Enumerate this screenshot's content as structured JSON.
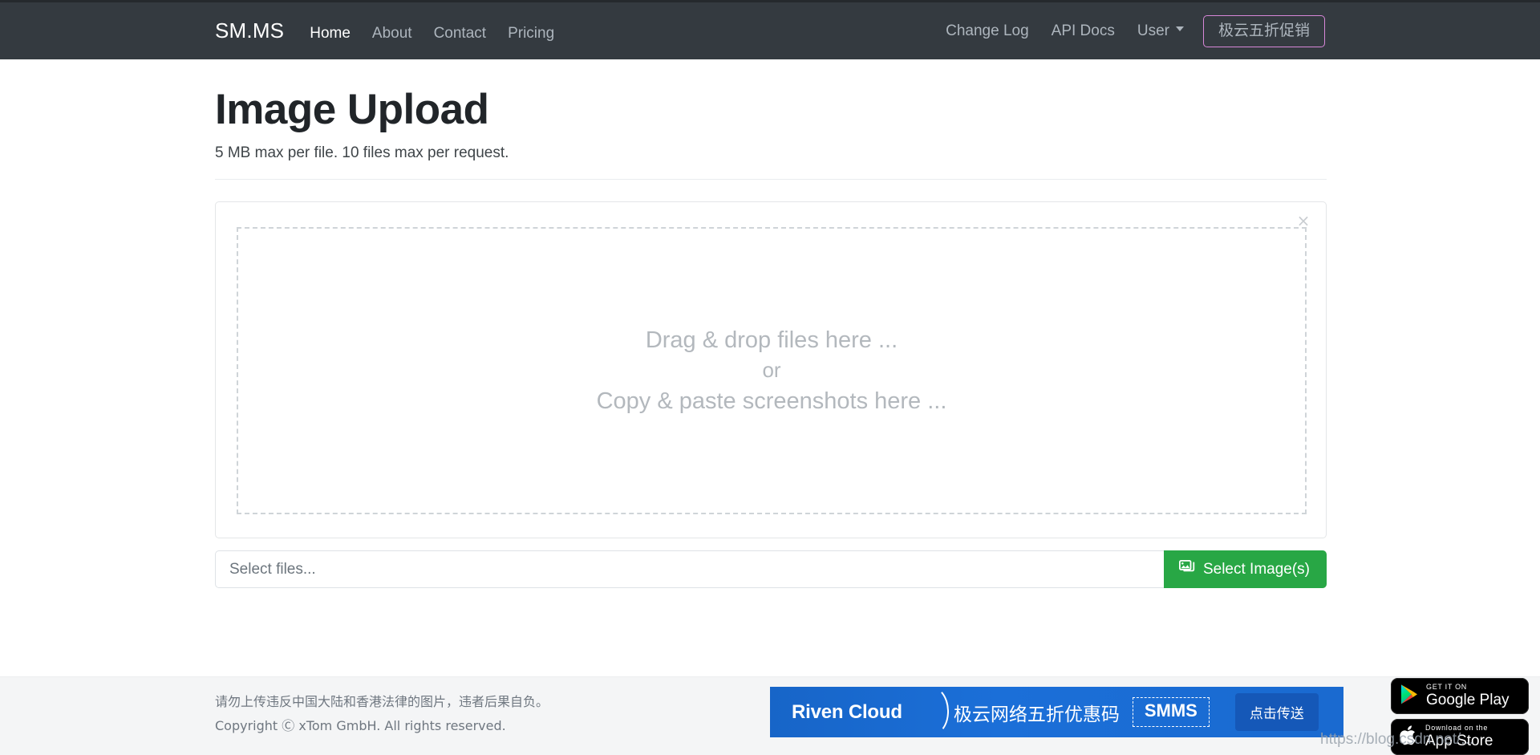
{
  "navbar": {
    "brand": "SM.MS",
    "left_links": [
      {
        "label": "Home",
        "active": true
      },
      {
        "label": "About",
        "active": false
      },
      {
        "label": "Contact",
        "active": false
      },
      {
        "label": "Pricing",
        "active": false
      }
    ],
    "right_links": [
      {
        "label": "Change Log"
      },
      {
        "label": "API Docs"
      },
      {
        "label": "User"
      }
    ],
    "user_dropdown_label": "User",
    "promo_button": "极云五折促销",
    "promo_border_color": "#d887d8",
    "background_color": "#343a40"
  },
  "main": {
    "title": "Image Upload",
    "subtitle": "5 MB max per file. 10 files max per request.",
    "card": {
      "close_label": "×",
      "dropzone": {
        "line1": "Drag & drop files here ...",
        "line2": "or",
        "line3": "Copy & paste screenshots here ..."
      }
    },
    "upload_form": {
      "file_input_placeholder": "Select files...",
      "file_input_value": "",
      "select_button_label": "Select Image(s)",
      "select_button_color": "#28a745"
    }
  },
  "footer": {
    "notice": "请勿上传违反中国大陆和香港法律的图片，违者后果自负。",
    "copyright": "Copyright Ⓒ xTom GmbH. All rights reserved.",
    "background_color": "#f4f5f6"
  },
  "banner_ad": {
    "brand": "Riven Cloud",
    "headline": "极云网络五折优惠码",
    "promo_code": "SMMS",
    "cta_label": "点击传送",
    "background_color": "#1b6fd8"
  },
  "store_badges": [
    {
      "pretext": "GET IT ON",
      "name": "Google Play",
      "icon": "google-play-icon"
    },
    {
      "pretext": "Download on the",
      "name": "App Store",
      "icon": "apple-icon"
    }
  ],
  "watermark": "https://blog.csdn.net/..."
}
